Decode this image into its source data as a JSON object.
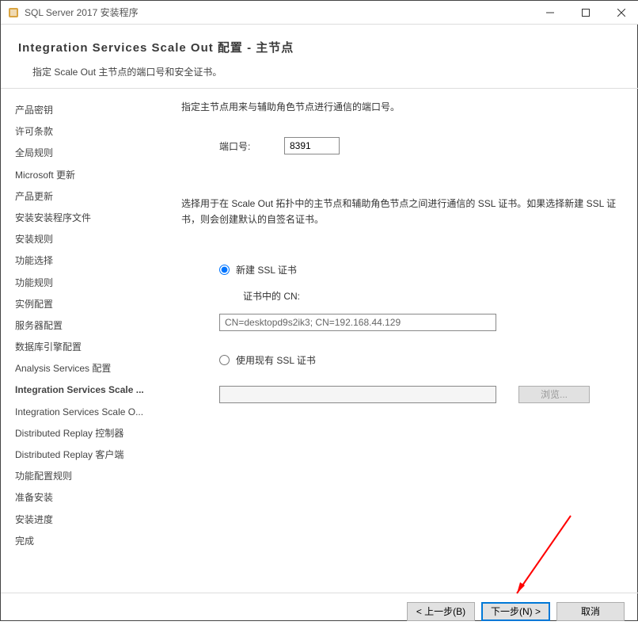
{
  "window": {
    "title": "SQL Server 2017 安装程序"
  },
  "header": {
    "title": "Integration  Services  Scale  Out 配置 - 主节点",
    "subtitle": "指定 Scale Out 主节点的端口号和安全证书。"
  },
  "sidebar": {
    "items": [
      "产品密钥",
      "许可条款",
      "全局规则",
      "Microsoft 更新",
      "产品更新",
      "安装安装程序文件",
      "安装规则",
      "功能选择",
      "功能规则",
      "实例配置",
      "服务器配置",
      "数据库引擎配置",
      "Analysis Services 配置",
      "Integration Services Scale ...",
      "Integration Services Scale O...",
      "Distributed Replay 控制器",
      "Distributed Replay 客户端",
      "功能配置规则",
      "准备安装",
      "安装进度",
      "完成"
    ],
    "selectedIndex": 13
  },
  "main": {
    "instruction1": "指定主节点用来与辅助角色节点进行通信的端口号。",
    "portLabel": "端口号:",
    "portValue": "8391",
    "instruction2": "选择用于在 Scale Out 拓扑中的主节点和辅助角色节点之间进行通信的 SSL 证书。如果选择新建 SSL 证书，则会创建默认的自签名证书。",
    "radioNew": "新建 SSL 证书",
    "cnLabel": "证书中的 CN:",
    "cnValue": "CN=desktopd9s2ik3; CN=192.168.44.129",
    "radioExisting": "使用现有 SSL 证书",
    "browseLabel": "浏览..."
  },
  "footer": {
    "back": "< 上一步(B)",
    "next": "下一步(N) >",
    "cancel": "取消"
  }
}
